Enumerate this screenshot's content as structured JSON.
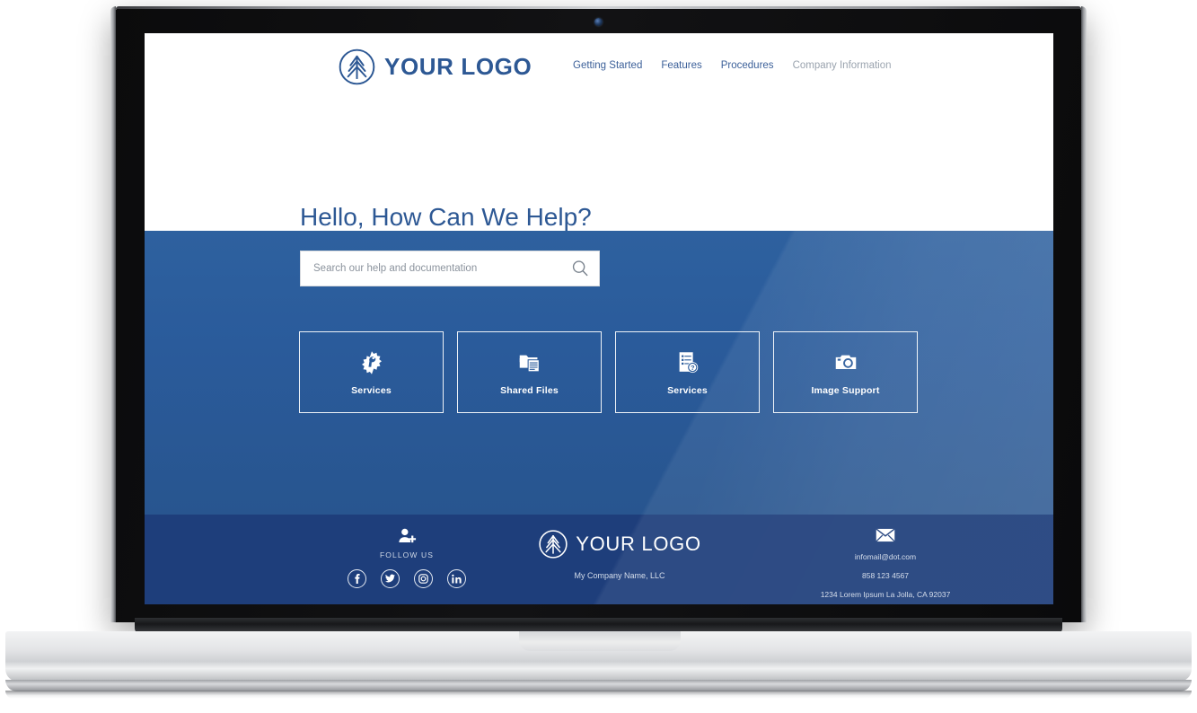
{
  "device": {
    "type": "laptop-mockup",
    "webcam": "webcam-icon"
  },
  "site": {
    "header": {
      "logo_icon": "pine-tree-circle-logo",
      "logo_text": "YOUR LOGO",
      "nav": [
        {
          "label": "Getting Started",
          "muted": false
        },
        {
          "label": "Features",
          "muted": false
        },
        {
          "label": "Procedures",
          "muted": false
        },
        {
          "label": "Company Information",
          "muted": true
        }
      ]
    },
    "hero": {
      "title": "Hello, How Can We Help?",
      "search": {
        "value": "",
        "placeholder": "Search our help and documentation",
        "icon": "search-icon"
      },
      "cards": [
        {
          "label": "Services",
          "icon": "gear-wrench-icon"
        },
        {
          "label": "Shared Files",
          "icon": "folder-document-icon"
        },
        {
          "label": "Services",
          "icon": "document-question-icon"
        },
        {
          "label": "Image Support",
          "icon": "camera-icon"
        }
      ]
    },
    "footer": {
      "follow": {
        "icon": "add-user-icon",
        "label": "FOLLOW US",
        "socials": [
          {
            "name": "facebook-icon",
            "glyph": "f"
          },
          {
            "name": "twitter-icon",
            "glyph": "t"
          },
          {
            "name": "instagram-icon",
            "glyph": "i"
          },
          {
            "name": "linkedin-icon",
            "glyph": "in"
          }
        ]
      },
      "brand": {
        "logo_icon": "pine-tree-circle-logo",
        "logo_text": "YOUR LOGO",
        "company": "My Company Name, LLC"
      },
      "contact": {
        "icon": "envelope-icon",
        "email": "infomail@dot.com",
        "phone": "858 123 4567",
        "address": "1234 Lorem Ipsum La Jolla, CA 92037"
      }
    }
  },
  "colors": {
    "brand_blue": "#2d5894",
    "hero_blue": "#2a5b9b",
    "footer_navy": "#1e3e7b",
    "white": "#ffffff",
    "nav_muted": "#9aa3ae"
  }
}
